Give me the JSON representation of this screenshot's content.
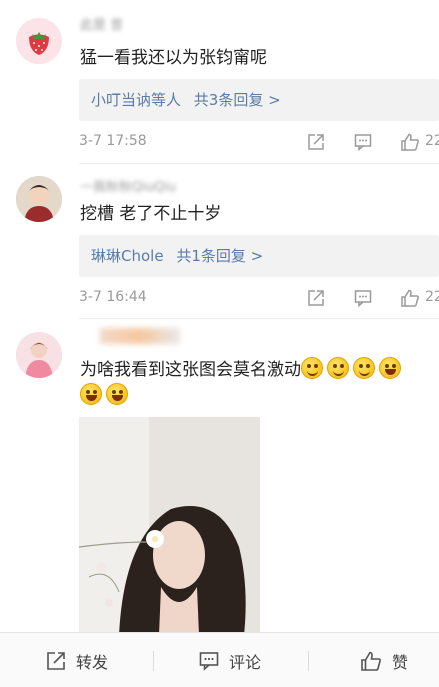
{
  "comments": [
    {
      "username": "此是 昔",
      "text": "猛一看我还以为张钧甯呢",
      "reply_users": "小叮当讷等人",
      "reply_count": "共3条回复 >",
      "time": "3-7 17:58",
      "likes": "22"
    },
    {
      "username": "一我秋秋QiuQiu",
      "text": "挖槽 老了不止十岁",
      "reply_users": "琳琳Chole",
      "reply_count": "共1条回复 >",
      "time": "3-7 16:44",
      "likes": "22"
    },
    {
      "username": "",
      "text": "为啥我看到这张图会莫名激动"
    }
  ],
  "bottom_bar": {
    "repost_label": "转发",
    "comment_label": "评论",
    "like_label": "赞"
  },
  "icons": [
    "share-icon",
    "comment-icon",
    "like-icon",
    "strawberry-avatar",
    "emoji-smile",
    "emoji-laugh"
  ]
}
